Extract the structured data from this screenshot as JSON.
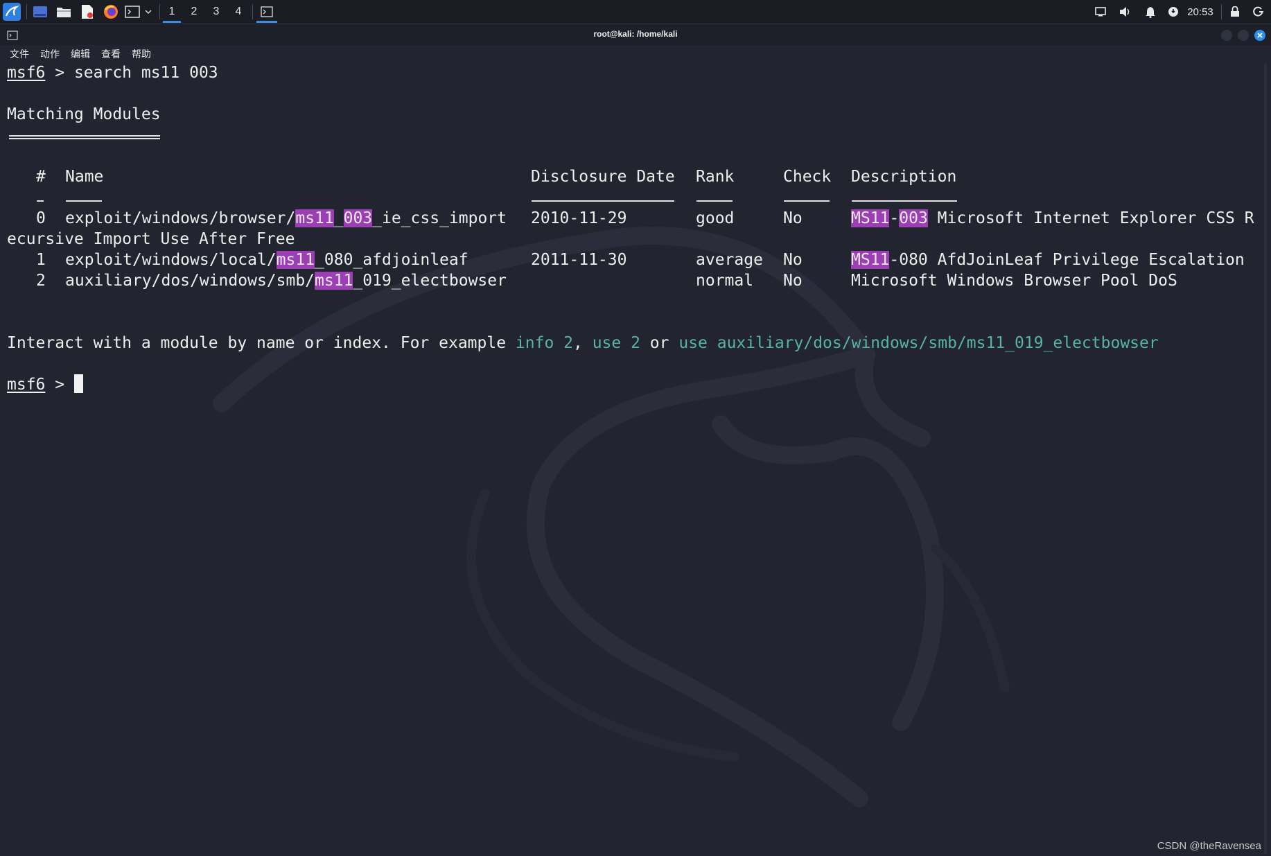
{
  "panel": {
    "workspaces": [
      "1",
      "2",
      "3",
      "4"
    ],
    "active_workspace": "1",
    "clock": "20:53"
  },
  "window": {
    "title": "root@kali: /home/kali"
  },
  "menubar": {
    "items": [
      "文件",
      "动作",
      "编辑",
      "查看",
      "帮助"
    ]
  },
  "terminal": {
    "prompt_label": "msf6",
    "prompt_sep": " > ",
    "command": "search ms11 003",
    "heading": "Matching Modules",
    "headers": {
      "num": "#",
      "name": "Name",
      "date": "Disclosure Date",
      "rank": "Rank",
      "check": "Check",
      "desc": "Description"
    },
    "rows": [
      {
        "num": "0",
        "name_prefix": "exploit/windows/browser/",
        "name_hl1": "ms11",
        "name_mid": "_",
        "name_hl2": "003",
        "name_suffix": "_ie_css_import",
        "date": "2010-11-29",
        "rank": "good",
        "check": "No",
        "desc_hl1": "MS11",
        "desc_mid": "-",
        "desc_hl2": "003",
        "desc_rest": " Microsoft Internet Explorer CSS R",
        "desc_wrap": "ecursive Import Use After Free"
      },
      {
        "num": "1",
        "name_prefix": "exploit/windows/local/",
        "name_hl1": "ms11",
        "name_suffix": "_080_afdjoinleaf",
        "date": "2011-11-30",
        "rank": "average",
        "check": "No",
        "desc_hl1": "MS11",
        "desc_rest": "-080 AfdJoinLeaf Privilege Escalation"
      },
      {
        "num": "2",
        "name_prefix": "auxiliary/dos/windows/smb/",
        "name_hl1": "ms11",
        "name_suffix": "_019_electbowser",
        "date": "",
        "rank": "normal",
        "check": "No",
        "desc_rest": "Microsoft Windows Browser Pool DoS"
      }
    ],
    "interact": {
      "text1": "Interact with a module by name or index. For example ",
      "cmd1": "info 2",
      "text2": ", ",
      "cmd2": "use 2",
      "text3": " or ",
      "cmd3": "use auxiliary/dos/windows/smb/ms11_019_electbowser"
    }
  },
  "watermark": "CSDN @theRavensea",
  "colors": {
    "background": "#22242f",
    "highlight": "#9c3fb5",
    "command_hint": "#57b3a8",
    "accent": "#3b8ee8"
  }
}
